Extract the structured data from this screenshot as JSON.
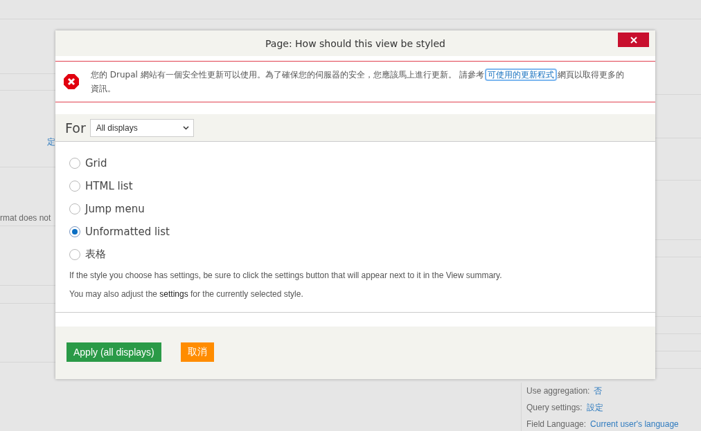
{
  "background": {
    "left_fragments": [
      {
        "kind": "link",
        "text": "定"
      },
      {
        "kind": "text",
        "text": "rmat does not"
      }
    ],
    "right_settings": [
      {
        "label": "Use aggregation:",
        "value": "否"
      },
      {
        "label": "Query settings:",
        "value": "設定"
      },
      {
        "label": "Field Language:",
        "value": "Current user's language"
      }
    ]
  },
  "dialog": {
    "title": "Page: How should this view be styled",
    "message": {
      "before": "您的 Drupal 網站有一個安全性更新可以使用。為了確保您的伺服器的安全，您應該馬上進行更新。 請參考",
      "link": "可使用的更新程式",
      "after": "網頁以取得更多的資訊。"
    },
    "for_label": "For",
    "for_select": {
      "value": "All displays"
    },
    "options": [
      {
        "label": "Grid",
        "selected": false
      },
      {
        "label": "HTML list",
        "selected": false
      },
      {
        "label": "Jump menu",
        "selected": false
      },
      {
        "label": "Unformatted list",
        "selected": true
      },
      {
        "label": "表格",
        "selected": false
      }
    ],
    "help": [
      "If the style you choose has settings, be sure to click the settings button that will appear next to it in the View summary.",
      "You may also adjust the **settings** for the currently selected style."
    ],
    "buttons": [
      {
        "kind": "primary",
        "label": "Apply (all displays)"
      },
      {
        "kind": "cancel",
        "label": "取消"
      }
    ]
  }
}
